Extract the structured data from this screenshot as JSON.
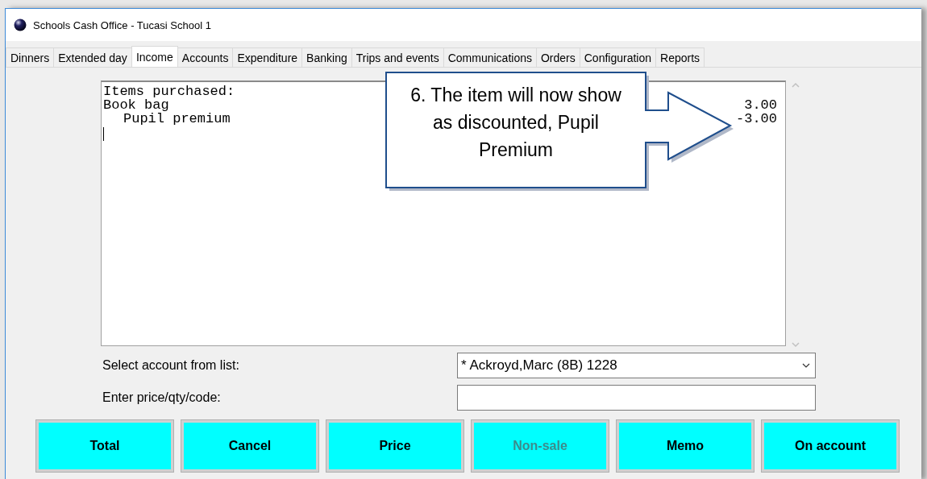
{
  "window": {
    "title": "Schools Cash Office - Tucasi School 1"
  },
  "tabs": [
    {
      "label": "Dinners",
      "selected": false
    },
    {
      "label": "Extended day",
      "selected": false
    },
    {
      "label": "Income",
      "selected": true
    },
    {
      "label": "Accounts",
      "selected": false
    },
    {
      "label": "Expenditure",
      "selected": false
    },
    {
      "label": "Banking",
      "selected": false
    },
    {
      "label": "Trips and events",
      "selected": false
    },
    {
      "label": "Communications",
      "selected": false
    },
    {
      "label": "Orders",
      "selected": false
    },
    {
      "label": "Configuration",
      "selected": false
    },
    {
      "label": "Reports",
      "selected": false
    }
  ],
  "receipt": {
    "lines": [
      {
        "kind": "header",
        "text": "Items purchased:"
      },
      {
        "kind": "item",
        "text": "Book bag",
        "amount": "3.00"
      },
      {
        "kind": "discount",
        "text": "Pupil premium",
        "amount": "-3.00"
      }
    ]
  },
  "callout": {
    "text": "6. The item will now show as discounted, Pupil Premium"
  },
  "fields": [
    {
      "kind": "select",
      "label": "Select account from list:",
      "value": "* Ackroyd,Marc (8B) 1228"
    },
    {
      "kind": "text",
      "label": "Enter price/qty/code:"
    }
  ],
  "buttons": [
    {
      "label": "Total",
      "disabled": false
    },
    {
      "label": "Cancel",
      "disabled": false
    },
    {
      "label": "Price",
      "disabled": false
    },
    {
      "label": "Non-sale",
      "disabled": true
    },
    {
      "label": "Memo",
      "disabled": false
    },
    {
      "label": "On account",
      "disabled": false
    }
  ]
}
